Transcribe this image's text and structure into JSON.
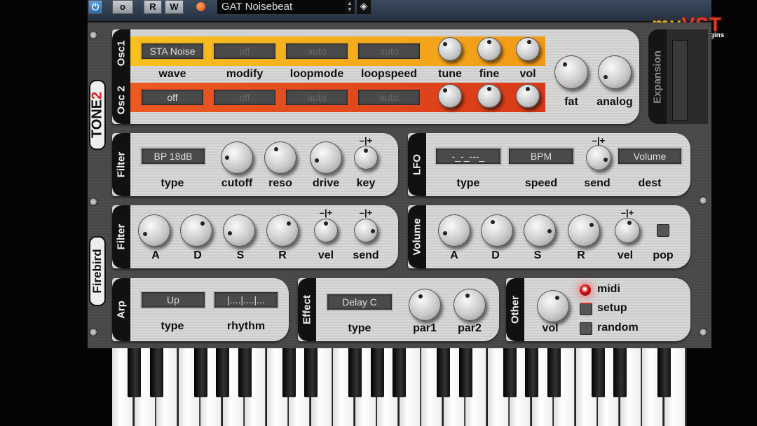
{
  "topbar": {
    "power_icon": "power-icon",
    "compare_label": "o",
    "read_label": "R",
    "write_label": "W",
    "preset_name": "GAT Noisebeat",
    "led_color": "#e8661a"
  },
  "watermark": {
    "text": "myVST",
    "sub": "free plugins"
  },
  "logos": {
    "brand": "Tone2",
    "product": "Firebird"
  },
  "osc": {
    "osc1": {
      "title": "Osc1",
      "wave": "STA Noise",
      "modify": "off",
      "loopmode": "auto",
      "loopspeed": "auto",
      "knobs": {
        "tune": 0.33,
        "fine": 0.5,
        "vol": 0.55
      },
      "color": "#f2a41a"
    },
    "osc2": {
      "title": "Osc 2",
      "wave": "off",
      "modify": "off",
      "loopmode": "auto",
      "loopspeed": "auto",
      "knobs": {
        "tune": 0.35,
        "fine": 0.5,
        "vol": 0.5
      },
      "color": "#e4461c"
    },
    "labels": {
      "wave": "wave",
      "modify": "modify",
      "loopmode": "loopmode",
      "loopspeed": "loopspeed",
      "tune": "tune",
      "fine": "fine",
      "vol": "vol",
      "fat": "fat",
      "analog": "analog"
    },
    "fat": 0.35,
    "analog": 0.06
  },
  "expansion": {
    "title": "Expansion"
  },
  "filter": {
    "title": "Filter",
    "type_value": "BP 18dB",
    "labels": {
      "type": "type",
      "cutoff": "cutoff",
      "reso": "reso",
      "drive": "drive",
      "key": "key"
    },
    "knobs": {
      "cutoff": 0.17,
      "reso": 0.4,
      "drive": 0.1,
      "key": 0.5
    },
    "bipolar": "–|+"
  },
  "lfo": {
    "title": "LFO",
    "type_value": "-_-_---_",
    "speed_value": "BPM",
    "dest_value": "Volume",
    "labels": {
      "type": "type",
      "speed": "speed",
      "send": "send",
      "dest": "dest"
    },
    "knobs": {
      "send": 0.9
    }
  },
  "filter_env": {
    "title": "Filter",
    "labels": {
      "a": "A",
      "d": "D",
      "s": "S",
      "r": "R",
      "vel": "vel",
      "send": "send"
    },
    "knobs": {
      "a": 0.08,
      "d": 0.65,
      "s": 0.1,
      "r": 0.65,
      "vel": 0.5,
      "send": 0.85
    }
  },
  "volume": {
    "title": "Volume",
    "labels": {
      "a": "A",
      "d": "D",
      "s": "S",
      "r": "R",
      "vel": "vel",
      "pop": "pop"
    },
    "knobs": {
      "a": 0.1,
      "d": 0.4,
      "s": 0.85,
      "r": 0.7,
      "vel": 0.55
    },
    "pop_on": false
  },
  "arp": {
    "title": "Arp",
    "type_value": "Up",
    "rhythm_value": "|....|....|...",
    "labels": {
      "type": "type",
      "rhythm": "rhythm"
    }
  },
  "effect": {
    "title": "Effect",
    "type_value": "Delay C",
    "labels": {
      "type": "type",
      "par1": "par1",
      "par2": "par2"
    },
    "knobs": {
      "par1": 0.4,
      "par2": 0.45
    }
  },
  "other": {
    "title": "Other",
    "labels": {
      "vol": "vol",
      "midi": "midi",
      "setup": "setup",
      "random": "random"
    },
    "knobs": {
      "vol": 0.6
    },
    "midi_led_color": "#e01010",
    "midi_active": true
  }
}
